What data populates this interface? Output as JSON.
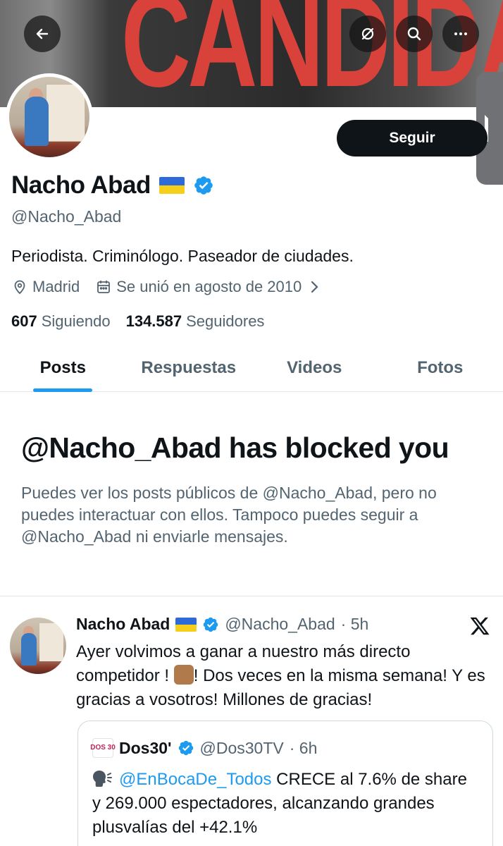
{
  "banner": {
    "text": "CANDIDATO"
  },
  "profile": {
    "follow_label": "Seguir",
    "name": "Nacho Abad",
    "handle": "@Nacho_Abad",
    "bio": "Periodista. Criminólogo. Paseador de ciudades.",
    "location": "Madrid",
    "joined": "Se unió en agosto de 2010",
    "following_count": "607",
    "following_label": "Siguiendo",
    "followers_count": "134.587",
    "followers_label": "Seguidores"
  },
  "tabs": [
    {
      "label": "Posts",
      "active": true
    },
    {
      "label": "Respuestas",
      "active": false
    },
    {
      "label": "Videos",
      "active": false
    },
    {
      "label": "Fotos",
      "active": false
    }
  ],
  "blocked": {
    "title": "@Nacho_Abad has blocked you",
    "description": "Puedes ver los posts públicos de @Nacho_Abad, pero no puedes interactuar con ellos. Tampoco puedes seguir a @Nacho_Abad ni enviarle mensajes."
  },
  "post": {
    "name": "Nacho Abad",
    "handle": "@Nacho_Abad",
    "time": "· 5h",
    "text_part1": "Ayer volvimos a ganar a nuestro más directo competidor ! ",
    "text_part2": "! Dos veces en la misma semana! Y es gracias a vosotros! Millones de gracias!",
    "quote": {
      "logo_text": "DOS 30",
      "name": "Dos30'",
      "handle": "@Dos30TV",
      "time": "· 6h",
      "mention": "@EnBocaDe_Todos",
      "text": " CRECE al 7.6% de share y 269.000 espectadores, alcanzando grandes plusvalías del +42.1%"
    }
  },
  "colors": {
    "accent": "#1d9bf0",
    "secondary_text": "#536471",
    "banner_text": "#d9423a"
  }
}
